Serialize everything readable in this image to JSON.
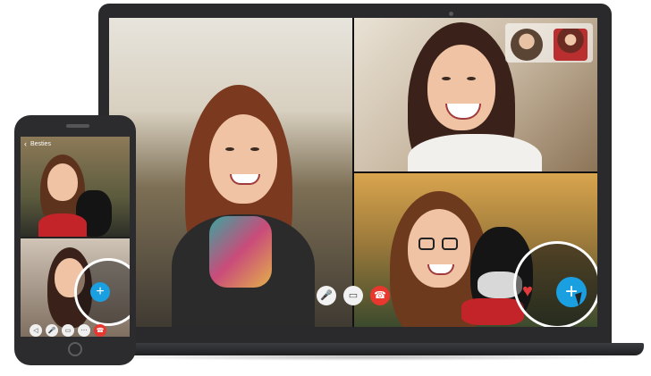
{
  "phone": {
    "header_title": "Besties",
    "back_icon": "back-icon"
  },
  "laptop": {
    "controls": [
      {
        "name": "mic-icon",
        "glyph": "🎤"
      },
      {
        "name": "video-icon",
        "glyph": "▭"
      },
      {
        "name": "end-call-icon",
        "glyph": "☎"
      }
    ]
  },
  "reactions": {
    "heart_glyph": "♥",
    "add_glyph": "+"
  },
  "colors": {
    "accent": "#1a9fe0",
    "end_call": "#e8372e",
    "heart": "#e23a3a"
  }
}
